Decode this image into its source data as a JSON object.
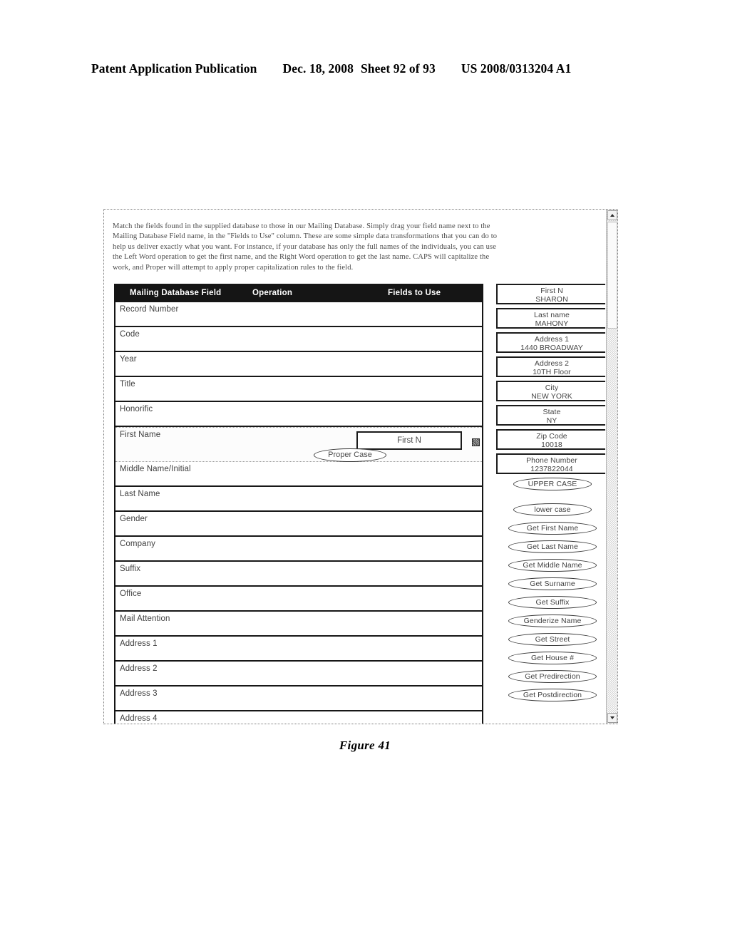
{
  "patent_header": {
    "publication": "Patent Application Publication",
    "date": "Dec. 18, 2008",
    "sheet": "Sheet 92 of 93",
    "number": "US 2008/0313204 A1"
  },
  "figure": {
    "caption": "Figure 41"
  },
  "dialog": {
    "instructions": "Match the fields found in the supplied database to those in our Mailing Database. Simply drag your field name next to the Mailing Database Field name, in the \"Fields to Use\" column. These are some simple data transformations that you can do to help us deliver exactly what you want. For instance, if your database has only the full names of the individuals, you can use the Left Word operation to get the first name, and the Right Word operation to get the last name. CAPS will capitalize the work, and Proper will attempt to apply proper capitalization rules to the field.",
    "table": {
      "headers": {
        "field": "Mailing Database Field",
        "operation": "Operation",
        "fields_to_use": "Fields to Use"
      },
      "rows": [
        {
          "label": "Record Number",
          "active": false
        },
        {
          "label": "Code",
          "active": false
        },
        {
          "label": "Year",
          "active": false
        },
        {
          "label": "Title",
          "active": false
        },
        {
          "label": "Honorific",
          "active": false
        },
        {
          "label": "First Name",
          "active": true,
          "operation": "Proper Case",
          "assigned_field": "First N"
        },
        {
          "label": "Middle Name/Initial",
          "active": false
        },
        {
          "label": "Last Name",
          "active": false
        },
        {
          "label": "Gender",
          "active": false
        },
        {
          "label": "Company",
          "active": false
        },
        {
          "label": "Suffix",
          "active": false
        },
        {
          "label": "Office",
          "active": false
        },
        {
          "label": "Mail Attention",
          "active": false
        },
        {
          "label": "Address 1",
          "active": false
        },
        {
          "label": "Address 2",
          "active": false
        },
        {
          "label": "Address 3",
          "active": false
        },
        {
          "label": "Address 4",
          "active": false
        }
      ]
    },
    "palette": {
      "source_fields": [
        {
          "name": "First N",
          "value": "SHARON"
        },
        {
          "name": "Last name",
          "value": "MAHONY"
        },
        {
          "name": "Address 1",
          "value": "1440 BROADWAY"
        },
        {
          "name": "Address 2",
          "value": "10TH Floor"
        },
        {
          "name": "City",
          "value": "NEW YORK"
        },
        {
          "name": "State",
          "value": "NY"
        },
        {
          "name": "Zip Code",
          "value": "10018"
        },
        {
          "name": "Phone Number",
          "value": "1237822044"
        }
      ],
      "operations": [
        {
          "label": "UPPER CASE",
          "wide": false,
          "gap": false
        },
        {
          "label": "lower case",
          "wide": false,
          "gap": true
        },
        {
          "label": "Get First Name",
          "wide": true,
          "gap": false
        },
        {
          "label": "Get Last Name",
          "wide": true,
          "gap": false
        },
        {
          "label": "Get Middle Name",
          "wide": true,
          "gap": false
        },
        {
          "label": "Get Surname",
          "wide": true,
          "gap": false
        },
        {
          "label": "Get Suffix",
          "wide": true,
          "gap": false
        },
        {
          "label": "Genderize Name",
          "wide": true,
          "gap": false
        },
        {
          "label": "Get Street",
          "wide": true,
          "gap": false
        },
        {
          "label": "Get House #",
          "wide": true,
          "gap": false
        },
        {
          "label": "Get Predirection",
          "wide": true,
          "gap": false
        },
        {
          "label": "Get Postdirection",
          "wide": true,
          "gap": false
        }
      ]
    },
    "scrollbar": {
      "up_arrow": "scroll-up-arrow",
      "down_arrow": "scroll-down-arrow"
    }
  },
  "colors": {
    "header_bar": "#151515",
    "text": "#3f3f3f",
    "frame": "#7a7a7a"
  }
}
